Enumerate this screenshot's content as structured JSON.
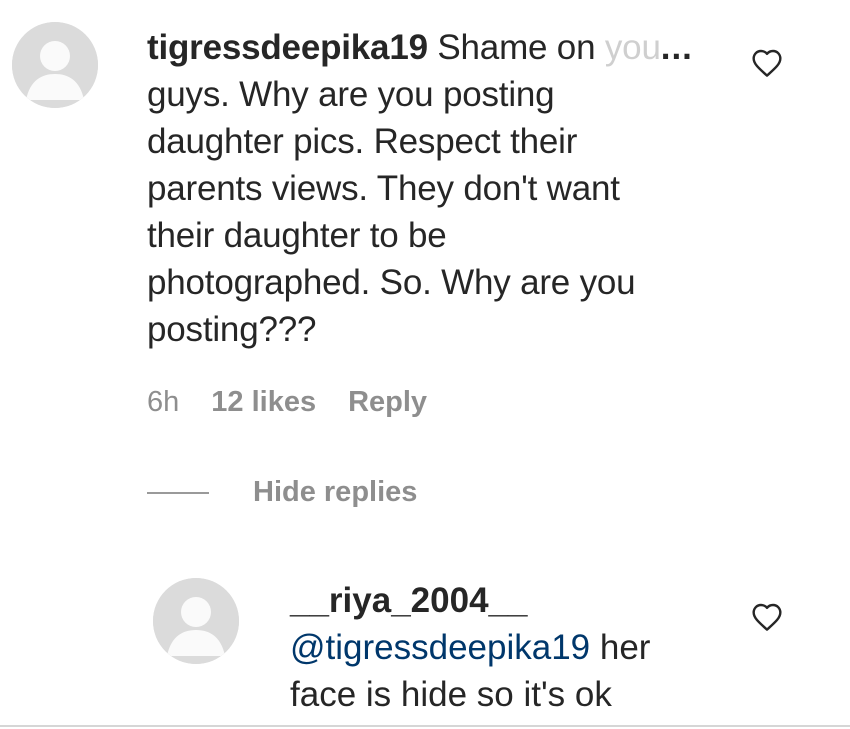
{
  "comment": {
    "username": "tigressdeepika19",
    "text_first_line": "Shame on",
    "text_faded": "you",
    "ellipsis": "...",
    "text_lines": [
      "guys. Why are you posting",
      "daughter pics. Respect their",
      "parents views. They don't want",
      "their daughter to be",
      "photographed. So. Why are you",
      "posting???"
    ],
    "time": "6h",
    "likes": "12 likes",
    "reply_label": "Reply",
    "hide_replies_label": "Hide replies"
  },
  "reply": {
    "username": "__riya_2004__",
    "mention": "@tigressdeepika19",
    "text_after_mention": " her",
    "text_second_line": "face is hide so it's ok"
  },
  "colors": {
    "text": "#262626",
    "muted": "#8e8e8e",
    "mention": "#00376b",
    "avatar_bg": "#dbdbdb"
  },
  "icons": {
    "heart": "heart-outline-icon",
    "avatar": "default-avatar-icon"
  }
}
